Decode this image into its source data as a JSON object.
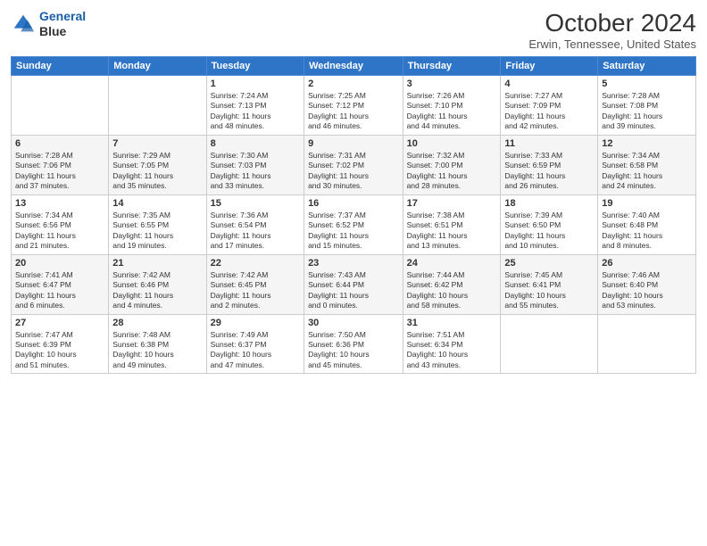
{
  "logo": {
    "line1": "General",
    "line2": "Blue"
  },
  "header": {
    "title": "October 2024",
    "location": "Erwin, Tennessee, United States"
  },
  "days_of_week": [
    "Sunday",
    "Monday",
    "Tuesday",
    "Wednesday",
    "Thursday",
    "Friday",
    "Saturday"
  ],
  "weeks": [
    [
      {
        "num": "",
        "info": ""
      },
      {
        "num": "",
        "info": ""
      },
      {
        "num": "1",
        "info": "Sunrise: 7:24 AM\nSunset: 7:13 PM\nDaylight: 11 hours\nand 48 minutes."
      },
      {
        "num": "2",
        "info": "Sunrise: 7:25 AM\nSunset: 7:12 PM\nDaylight: 11 hours\nand 46 minutes."
      },
      {
        "num": "3",
        "info": "Sunrise: 7:26 AM\nSunset: 7:10 PM\nDaylight: 11 hours\nand 44 minutes."
      },
      {
        "num": "4",
        "info": "Sunrise: 7:27 AM\nSunset: 7:09 PM\nDaylight: 11 hours\nand 42 minutes."
      },
      {
        "num": "5",
        "info": "Sunrise: 7:28 AM\nSunset: 7:08 PM\nDaylight: 11 hours\nand 39 minutes."
      }
    ],
    [
      {
        "num": "6",
        "info": "Sunrise: 7:28 AM\nSunset: 7:06 PM\nDaylight: 11 hours\nand 37 minutes."
      },
      {
        "num": "7",
        "info": "Sunrise: 7:29 AM\nSunset: 7:05 PM\nDaylight: 11 hours\nand 35 minutes."
      },
      {
        "num": "8",
        "info": "Sunrise: 7:30 AM\nSunset: 7:03 PM\nDaylight: 11 hours\nand 33 minutes."
      },
      {
        "num": "9",
        "info": "Sunrise: 7:31 AM\nSunset: 7:02 PM\nDaylight: 11 hours\nand 30 minutes."
      },
      {
        "num": "10",
        "info": "Sunrise: 7:32 AM\nSunset: 7:00 PM\nDaylight: 11 hours\nand 28 minutes."
      },
      {
        "num": "11",
        "info": "Sunrise: 7:33 AM\nSunset: 6:59 PM\nDaylight: 11 hours\nand 26 minutes."
      },
      {
        "num": "12",
        "info": "Sunrise: 7:34 AM\nSunset: 6:58 PM\nDaylight: 11 hours\nand 24 minutes."
      }
    ],
    [
      {
        "num": "13",
        "info": "Sunrise: 7:34 AM\nSunset: 6:56 PM\nDaylight: 11 hours\nand 21 minutes."
      },
      {
        "num": "14",
        "info": "Sunrise: 7:35 AM\nSunset: 6:55 PM\nDaylight: 11 hours\nand 19 minutes."
      },
      {
        "num": "15",
        "info": "Sunrise: 7:36 AM\nSunset: 6:54 PM\nDaylight: 11 hours\nand 17 minutes."
      },
      {
        "num": "16",
        "info": "Sunrise: 7:37 AM\nSunset: 6:52 PM\nDaylight: 11 hours\nand 15 minutes."
      },
      {
        "num": "17",
        "info": "Sunrise: 7:38 AM\nSunset: 6:51 PM\nDaylight: 11 hours\nand 13 minutes."
      },
      {
        "num": "18",
        "info": "Sunrise: 7:39 AM\nSunset: 6:50 PM\nDaylight: 11 hours\nand 10 minutes."
      },
      {
        "num": "19",
        "info": "Sunrise: 7:40 AM\nSunset: 6:48 PM\nDaylight: 11 hours\nand 8 minutes."
      }
    ],
    [
      {
        "num": "20",
        "info": "Sunrise: 7:41 AM\nSunset: 6:47 PM\nDaylight: 11 hours\nand 6 minutes."
      },
      {
        "num": "21",
        "info": "Sunrise: 7:42 AM\nSunset: 6:46 PM\nDaylight: 11 hours\nand 4 minutes."
      },
      {
        "num": "22",
        "info": "Sunrise: 7:42 AM\nSunset: 6:45 PM\nDaylight: 11 hours\nand 2 minutes."
      },
      {
        "num": "23",
        "info": "Sunrise: 7:43 AM\nSunset: 6:44 PM\nDaylight: 11 hours\nand 0 minutes."
      },
      {
        "num": "24",
        "info": "Sunrise: 7:44 AM\nSunset: 6:42 PM\nDaylight: 10 hours\nand 58 minutes."
      },
      {
        "num": "25",
        "info": "Sunrise: 7:45 AM\nSunset: 6:41 PM\nDaylight: 10 hours\nand 55 minutes."
      },
      {
        "num": "26",
        "info": "Sunrise: 7:46 AM\nSunset: 6:40 PM\nDaylight: 10 hours\nand 53 minutes."
      }
    ],
    [
      {
        "num": "27",
        "info": "Sunrise: 7:47 AM\nSunset: 6:39 PM\nDaylight: 10 hours\nand 51 minutes."
      },
      {
        "num": "28",
        "info": "Sunrise: 7:48 AM\nSunset: 6:38 PM\nDaylight: 10 hours\nand 49 minutes."
      },
      {
        "num": "29",
        "info": "Sunrise: 7:49 AM\nSunset: 6:37 PM\nDaylight: 10 hours\nand 47 minutes."
      },
      {
        "num": "30",
        "info": "Sunrise: 7:50 AM\nSunset: 6:36 PM\nDaylight: 10 hours\nand 45 minutes."
      },
      {
        "num": "31",
        "info": "Sunrise: 7:51 AM\nSunset: 6:34 PM\nDaylight: 10 hours\nand 43 minutes."
      },
      {
        "num": "",
        "info": ""
      },
      {
        "num": "",
        "info": ""
      }
    ]
  ]
}
